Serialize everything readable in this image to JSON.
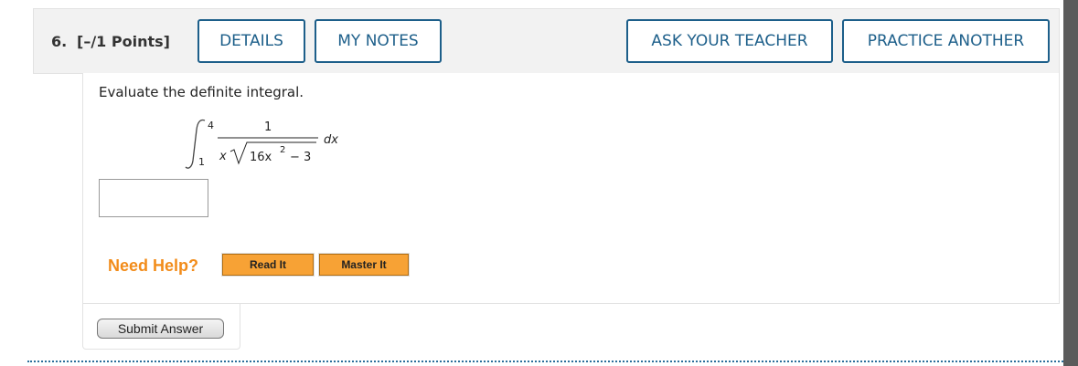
{
  "question": {
    "number": "6.",
    "points": "[–/1 Points]"
  },
  "header_buttons": {
    "details": "DETAILS",
    "my_notes": "MY NOTES",
    "ask_teacher": "ASK YOUR TEACHER",
    "practice_another": "PRACTICE ANOTHER"
  },
  "prompt": "Evaluate the definite integral.",
  "integral": {
    "upper_limit": "4",
    "lower_limit": "1",
    "numerator": "1",
    "denominator_prefix": "x",
    "radicand_coef": "16x",
    "radicand_exp": "2",
    "radicand_rest": "− 3",
    "differential": "dx"
  },
  "answer_input": {
    "value": ""
  },
  "help": {
    "label": "Need Help?",
    "read_it": "Read It",
    "master_it": "Master It"
  },
  "submit_label": "Submit Answer",
  "colors": {
    "link_blue": "#1d5f8a",
    "help_orange": "#f28c1a",
    "help_button": "#f7a235"
  }
}
